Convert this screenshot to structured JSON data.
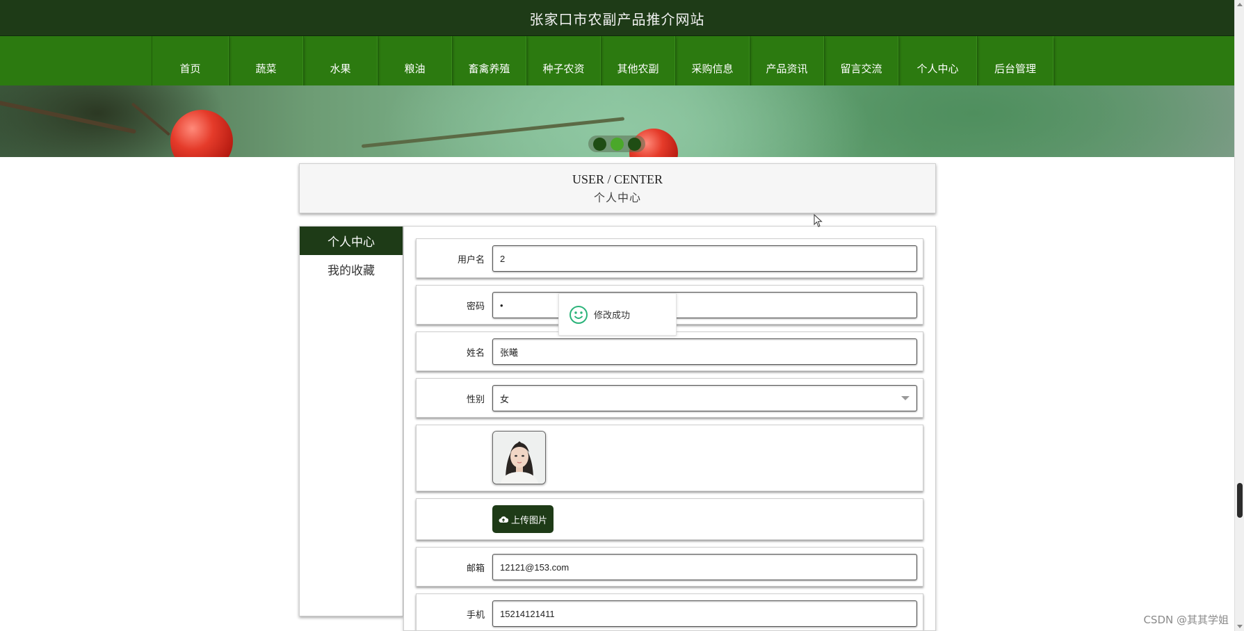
{
  "site": {
    "title": "张家口市农副产品推介网站"
  },
  "nav": {
    "items": [
      {
        "label": "首页"
      },
      {
        "label": "蔬菜"
      },
      {
        "label": "水果"
      },
      {
        "label": "粮油"
      },
      {
        "label": "畜禽养殖"
      },
      {
        "label": "种子农资"
      },
      {
        "label": "其他农副"
      },
      {
        "label": "采购信息"
      },
      {
        "label": "产品资讯"
      },
      {
        "label": "留言交流"
      },
      {
        "label": "个人中心"
      },
      {
        "label": "后台管理"
      }
    ]
  },
  "banner": {
    "dots": 3,
    "active_dot": 2
  },
  "header": {
    "en": "USER / CENTER",
    "cn": "个人中心"
  },
  "sidebar": {
    "items": [
      {
        "label": "个人中心",
        "active": true
      },
      {
        "label": "我的收藏",
        "active": false
      }
    ]
  },
  "form": {
    "username": {
      "label": "用户名",
      "value": "2"
    },
    "password": {
      "label": "密码",
      "value": "•"
    },
    "name": {
      "label": "姓名",
      "value": "张曦"
    },
    "gender": {
      "label": "性别",
      "value": "女"
    },
    "upload_label": "上传图片",
    "email": {
      "label": "邮箱",
      "value": "12121@153.com"
    },
    "phone": {
      "label": "手机",
      "value": "15214121411"
    }
  },
  "toast": {
    "text": "修改成功"
  },
  "watermark": "CSDN @其其学姐",
  "colors": {
    "dark_green": "#1e3b17",
    "nav_green": "#2c7a10",
    "toast_icon": "#2bb37a"
  },
  "icons": {
    "toast": "smile-icon",
    "upload": "cloud-upload-icon",
    "select": "chevron-down-icon"
  }
}
